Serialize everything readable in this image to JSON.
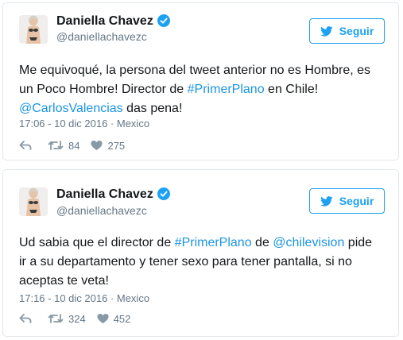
{
  "tweets": [
    {
      "display_name": "Daniella Chavez",
      "handle": "@daniellachavezc",
      "follow_label": "Seguir",
      "text": [
        {
          "t": "Me equivoqué, la persona del tweet anterior no es Hombre, es un Poco Hombre! Director de ",
          "link": false
        },
        {
          "t": "#PrimerPlano",
          "link": true
        },
        {
          "t": " en Chile! ",
          "link": false
        },
        {
          "t": "@CarlosValencias",
          "link": true
        },
        {
          "t": " das pena!",
          "link": false
        }
      ],
      "timestamp": "17:06 - 10 dic 2016",
      "location": "Mexico",
      "retweets": "84",
      "likes": "275"
    },
    {
      "display_name": "Daniella Chavez",
      "handle": "@daniellachavezc",
      "follow_label": "Seguir",
      "text": [
        {
          "t": "Ud sabia que el director de ",
          "link": false
        },
        {
          "t": "#PrimerPlano",
          "link": true
        },
        {
          "t": " de ",
          "link": false
        },
        {
          "t": "@chilevision",
          "link": true
        },
        {
          "t": " pide ir a su departamento y tener sexo para tener pantalla, si no aceptas te veta!",
          "link": false
        }
      ],
      "timestamp": "17:16 - 10 dic 2016",
      "location": "Mexico",
      "retweets": "324",
      "likes": "452"
    }
  ],
  "meta_separator": " · ",
  "colors": {
    "accent": "#1da1f2",
    "link": "#1b95e0",
    "muted": "#657786",
    "border": "#e1e8ed"
  },
  "icons": {
    "verified": "verified-badge-icon",
    "follow": "twitter-bird-icon",
    "reply": "reply-arrow-icon",
    "retweet": "retweet-icon",
    "like": "heart-icon"
  }
}
